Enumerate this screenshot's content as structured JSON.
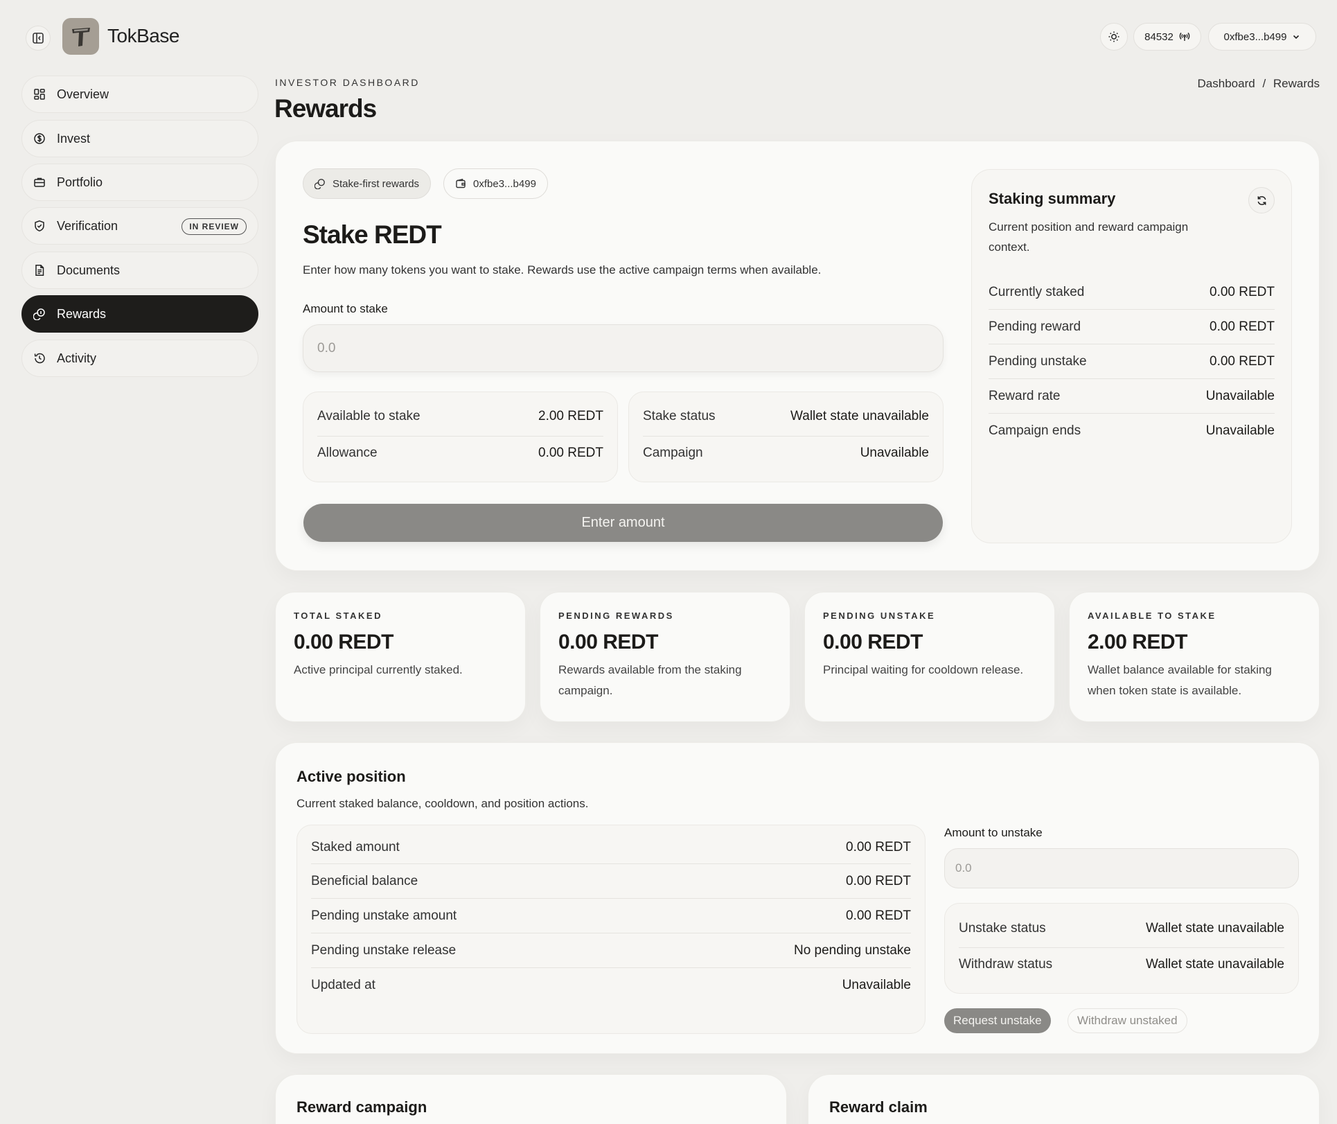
{
  "app": {
    "brand": "TokBase"
  },
  "topbar": {
    "chain_id": "84532",
    "wallet": "0xfbe3...b499"
  },
  "sidebar": {
    "items": [
      {
        "label": "Overview"
      },
      {
        "label": "Invest"
      },
      {
        "label": "Portfolio"
      },
      {
        "label": "Verification",
        "badge": "IN REVIEW"
      },
      {
        "label": "Documents"
      },
      {
        "label": "Rewards"
      },
      {
        "label": "Activity"
      }
    ]
  },
  "header": {
    "eyebrow": "INVESTOR DASHBOARD",
    "title": "Rewards",
    "breadcrumb": {
      "root": "Dashboard",
      "sep": "/",
      "current": "Rewards"
    }
  },
  "stake": {
    "chip_campaign": "Stake-first rewards",
    "chip_wallet": "0xfbe3...b499",
    "title": "Stake REDT",
    "description": "Enter how many tokens you want to stake. Rewards use the active campaign terms when available.",
    "amount_label": "Amount to stake",
    "amount_placeholder": "0.0",
    "left_rows": [
      {
        "label": "Available to stake",
        "value": "2.00 REDT"
      },
      {
        "label": "Allowance",
        "value": "0.00 REDT"
      }
    ],
    "right_rows": [
      {
        "label": "Stake status",
        "value": "Wallet state unavailable"
      },
      {
        "label": "Campaign",
        "value": "Unavailable"
      }
    ],
    "button": "Enter amount"
  },
  "summary": {
    "title": "Staking summary",
    "description": "Current position and reward campaign context.",
    "rows": [
      {
        "label": "Currently staked",
        "value": "0.00 REDT"
      },
      {
        "label": "Pending reward",
        "value": "0.00 REDT"
      },
      {
        "label": "Pending unstake",
        "value": "0.00 REDT"
      },
      {
        "label": "Reward rate",
        "value": "Unavailable"
      },
      {
        "label": "Campaign ends",
        "value": "Unavailable"
      }
    ]
  },
  "stats": [
    {
      "label": "TOTAL STAKED",
      "value": "0.00 REDT",
      "desc": "Active principal currently staked."
    },
    {
      "label": "PENDING REWARDS",
      "value": "0.00 REDT",
      "desc": "Rewards available from the staking campaign."
    },
    {
      "label": "PENDING UNSTAKE",
      "value": "0.00 REDT",
      "desc": "Principal waiting for cooldown release."
    },
    {
      "label": "AVAILABLE TO STAKE",
      "value": "2.00 REDT",
      "desc": "Wallet balance available for staking when token state is available."
    }
  ],
  "position": {
    "title": "Active position",
    "description": "Current staked balance, cooldown, and position actions.",
    "rows": [
      {
        "label": "Staked amount",
        "value": "0.00 REDT"
      },
      {
        "label": "Beneficial balance",
        "value": "0.00 REDT"
      },
      {
        "label": "Pending unstake amount",
        "value": "0.00 REDT"
      },
      {
        "label": "Pending unstake release",
        "value": "No pending unstake"
      },
      {
        "label": "Updated at",
        "value": "Unavailable"
      }
    ],
    "unstake_label": "Amount to unstake",
    "unstake_placeholder": "0.0",
    "status_rows": [
      {
        "label": "Unstake status",
        "value": "Wallet state unavailable"
      },
      {
        "label": "Withdraw status",
        "value": "Wallet state unavailable"
      }
    ],
    "request_button": "Request unstake",
    "withdraw_button": "Withdraw unstaked"
  },
  "bottom": {
    "campaign_title": "Reward campaign",
    "claim_title": "Reward claim"
  }
}
